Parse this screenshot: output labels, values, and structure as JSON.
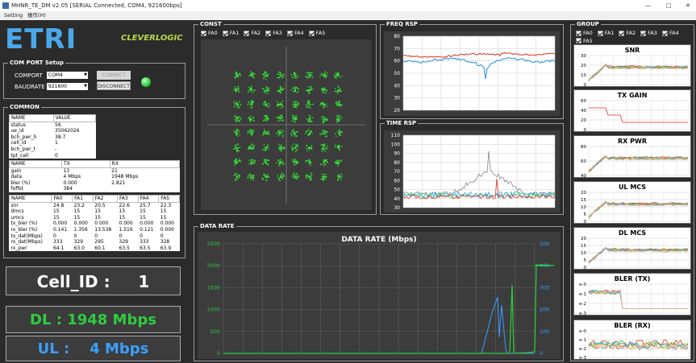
{
  "window": {
    "title": "MHNR_TE_DM v2.05   [SERIAL Connected, COM4, 921600bps]",
    "controls": [
      "—",
      "□",
      "✕"
    ]
  },
  "menu": [
    "Setting",
    "操作(H)"
  ],
  "logos": {
    "etri": "ETRI",
    "clever": "CLEVERLOGIC"
  },
  "com": {
    "title": "COM PORT Setup",
    "comport_label": "COMPORT",
    "comport_value": "COM4",
    "baud_label": "BAUDRATE",
    "baud_value": "921600",
    "connect": "CONNECT",
    "disconnect": "DISCONNECT",
    "led": "#2ecc40"
  },
  "common": {
    "title": "COMMON",
    "t1": {
      "headers": [
        "NAME",
        "VALUE"
      ],
      "rows": [
        [
          "status",
          "56"
        ],
        [
          "ue_id",
          "35062026"
        ],
        [
          "bch_pwr_h",
          "38.7"
        ],
        [
          "cell_id",
          "1"
        ],
        [
          "bch_pwr_t",
          "-"
        ],
        [
          "tpt_cell",
          "0"
        ]
      ]
    },
    "t2": {
      "headers": [
        "NAME",
        "TX",
        "RX"
      ],
      "rows": [
        [
          "gain",
          "13",
          "21"
        ],
        [
          "data",
          "4 Mbps",
          "1948 Mbps"
        ],
        [
          "bler (%)",
          "0.000",
          "2.821"
        ],
        [
          "foffst",
          "384",
          ""
        ]
      ]
    },
    "t3": {
      "headers": [
        "NAME",
        "FA0",
        "FA1",
        "FA2",
        "FA3",
        "FA4",
        "FA5"
      ],
      "rows": [
        [
          "snr",
          "24.8",
          "23.2",
          "20.5",
          "22.6",
          "25.7",
          "22.3"
        ],
        [
          "dmcs",
          "15",
          "15",
          "15",
          "15",
          "15",
          "15"
        ],
        [
          "umcs",
          "15",
          "15",
          "15",
          "15",
          "15",
          "15"
        ],
        [
          "tx_bler (%)",
          "0.000",
          "0.000",
          "0.000",
          "0.000",
          "0.000",
          "0.000"
        ],
        [
          "rx_bler (%)",
          "0.141",
          "1.356",
          "13.538",
          "1.516",
          "0.121",
          "0.000"
        ],
        [
          "tx_dat(Mbps)",
          "0",
          "0",
          "0",
          "0",
          "0",
          "0"
        ],
        [
          "rx_dat(Mbps)",
          "333",
          "329",
          "295",
          "329",
          "333",
          "328"
        ],
        [
          "rx_pwr",
          "64.1",
          "63.0",
          "60.1",
          "63.5",
          "63.5",
          "63.9"
        ]
      ]
    }
  },
  "status": {
    "cell": "Cell_ID :     1",
    "dl": "DL : 1948 Mbps",
    "ul": "UL :    4 Mbps"
  },
  "fa": [
    "FA0",
    "FA1",
    "FA2",
    "FA3",
    "FA4",
    "FA5"
  ],
  "const": {
    "title": "CONST"
  },
  "freq": {
    "title": "FREQ RSP",
    "y": [
      "80",
      "70",
      "60",
      "50",
      "40",
      "30",
      "20"
    ]
  },
  "time": {
    "title": "TIME RSP",
    "y": [
      "110",
      "100",
      "90",
      "80",
      "70",
      "60",
      "50",
      "40",
      "30"
    ]
  },
  "datarate": {
    "title": "DATA RATE",
    "chart_title": "DATA RATE (Mbps)",
    "yl": [
      "2500",
      "2000",
      "1500",
      "1000",
      "500",
      "0"
    ],
    "yr": [
      "500",
      "400",
      "300",
      "200",
      "100",
      "0"
    ],
    "left_color": "#2ecc40",
    "right_color": "#3aa0ff"
  },
  "group": {
    "title": "GROUP",
    "charts": [
      {
        "name": "SNR",
        "y": [
          "30",
          "20",
          "10",
          "0"
        ]
      },
      {
        "name": "TX GAIN",
        "y": [
          "60",
          "40",
          "20",
          "0"
        ]
      },
      {
        "name": "RX PWR",
        "y": [
          "80",
          "60",
          "40"
        ]
      },
      {
        "name": "UL MCS",
        "y": [
          "20",
          "15",
          "10",
          "5",
          "0"
        ]
      },
      {
        "name": "DL MCS",
        "y": [
          "20",
          "15",
          "10",
          "5",
          "0"
        ]
      },
      {
        "name": "BLER (TX)",
        "y": [
          "e-0",
          "e-1",
          "e-2",
          "e-3"
        ]
      },
      {
        "name": "BLER (RX)",
        "y": [
          "e-0",
          "e-1",
          "e-2",
          "e-3"
        ]
      }
    ]
  }
}
